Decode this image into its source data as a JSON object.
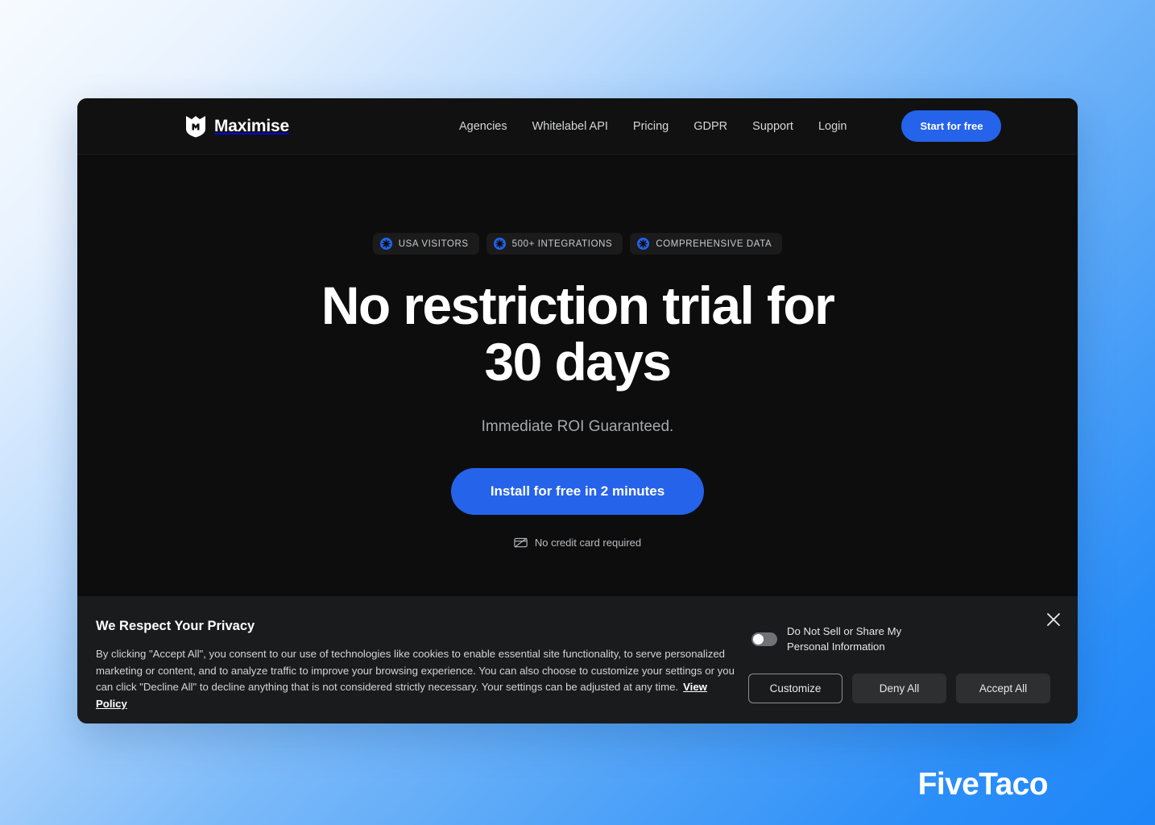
{
  "brand": {
    "name": "Maximise",
    "logo_icon": "maximise-shield-m-icon"
  },
  "nav": {
    "links": [
      {
        "label": "Agencies"
      },
      {
        "label": "Whitelabel API"
      },
      {
        "label": "Pricing"
      },
      {
        "label": "GDPR"
      },
      {
        "label": "Support"
      },
      {
        "label": "Login"
      }
    ],
    "cta_label": "Start for free"
  },
  "hero": {
    "badges": [
      {
        "label": "USA VISITORS",
        "icon": "blue-asterisk-icon"
      },
      {
        "label": "500+ INTEGRATIONS",
        "icon": "blue-asterisk-icon"
      },
      {
        "label": "COMPREHENSIVE DATA",
        "icon": "blue-asterisk-icon"
      }
    ],
    "headline": "No restriction trial for 30 days",
    "subheadline": "Immediate ROI Guaranteed.",
    "cta_label": "Install for free in 2 minutes",
    "note": "No credit card required",
    "note_icon": "no-credit-card-icon"
  },
  "cookie_banner": {
    "title": "We Respect Your Privacy",
    "body": "By clicking \"Accept All\", you consent to our use of technologies like cookies to enable essential site functionality, to serve personalized marketing or content, and to analyze traffic to improve your browsing experience. You can also choose to customize your settings or you can click \"Decline All\" to decline anything that is not considered strictly necessary. Your settings can be adjusted at any time.",
    "policy_link": "View Policy",
    "do_not_sell_label": "Do Not Sell or Share My Personal Information",
    "do_not_sell_state": "off",
    "buttons": {
      "customize": "Customize",
      "deny_all": "Deny All",
      "accept_all": "Accept All"
    },
    "close_icon": "close-icon"
  },
  "watermark": {
    "text": "FiveTaco"
  },
  "colors": {
    "accent_blue": "#2563eb",
    "page_gradient_start": "#f7fbff",
    "page_gradient_end": "#1d86f8",
    "card_background": "#0d0d0d",
    "banner_background": "#1a1b1d"
  }
}
